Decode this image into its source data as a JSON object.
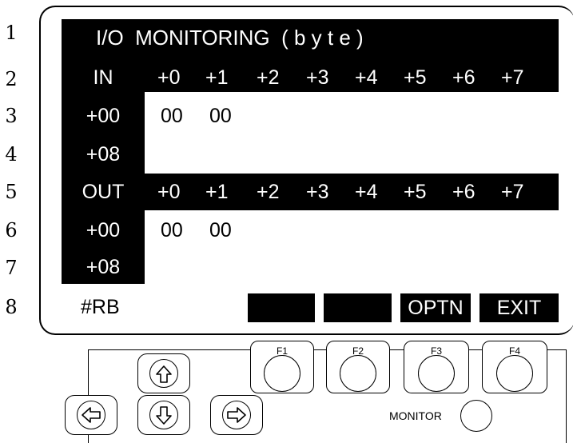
{
  "line_numbers": [
    "1",
    "2",
    "3",
    "4",
    "5",
    "6",
    "7",
    "8"
  ],
  "screen": {
    "title": "I/O  MONITORING  ( b y t e )",
    "in_section": {
      "label": "IN",
      "columns": [
        "+0",
        "+1",
        "+2",
        "+3",
        "+4",
        "+5",
        "+6",
        "+7"
      ],
      "rows": [
        {
          "offset": "+00",
          "values": [
            "00",
            "00"
          ]
        },
        {
          "offset": "+08",
          "values": []
        }
      ]
    },
    "out_section": {
      "label": "OUT",
      "columns": [
        "+0",
        "+1",
        "+2",
        "+3",
        "+4",
        "+5",
        "+6",
        "+7"
      ],
      "rows": [
        {
          "offset": "+00",
          "values": [
            "00",
            "00"
          ]
        },
        {
          "offset": "+08",
          "values": []
        }
      ]
    },
    "status": "#RB",
    "softkeys": [
      "",
      "",
      "OPTN",
      "EXIT"
    ]
  },
  "keypad": {
    "function_keys": [
      "F1",
      "F2",
      "F3",
      "F4"
    ],
    "monitor_label": "MONITOR",
    "arrow_icons": [
      "arrow-up-icon",
      "arrow-left-icon",
      "arrow-down-icon",
      "arrow-right-icon"
    ]
  }
}
